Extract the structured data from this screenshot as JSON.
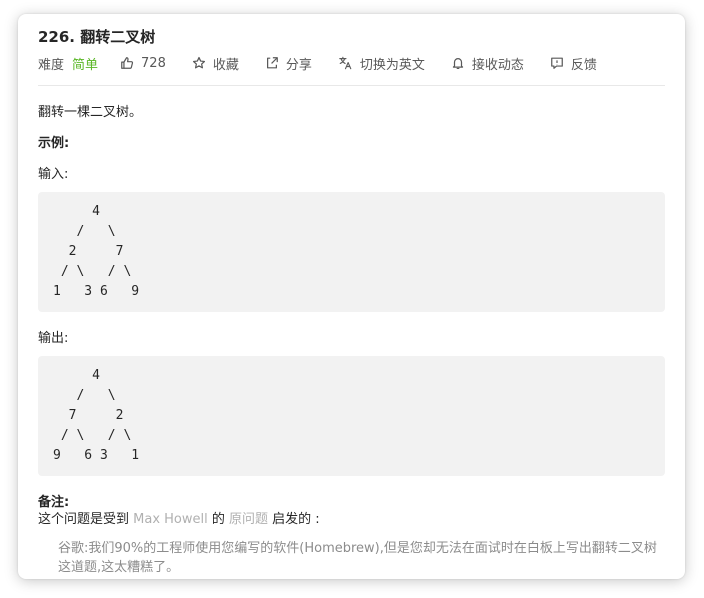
{
  "problem": {
    "title": "226. 翻转二叉树",
    "difficulty_label": "难度",
    "difficulty_value": "简单",
    "likes": "728",
    "collect_label": "收藏",
    "share_label": "分享",
    "lang_switch_label": "切换为英文",
    "follow_label": "接收动态",
    "feedback_label": "反馈"
  },
  "content": {
    "description": "翻转一棵二叉树。",
    "example_heading": "示例:",
    "input_label": "输入:",
    "input_tree": "     4\n   /   \\\n  2     7\n / \\   / \\\n1   3 6   9",
    "output_label": "输出:",
    "output_tree": "     4\n   /   \\\n  7     2\n / \\   / \\\n9   6 3   1",
    "note_heading": "备注:",
    "note_prefix": "这个问题是受到 ",
    "note_author": "Max Howell",
    "note_middle": " 的 ",
    "note_link": "原问题",
    "note_suffix": " 启发的 :",
    "quote": "谷歌:我们90%的工程师使用您编写的软件(Homebrew),但是您却无法在面试时在白板上写出翻转二叉树这道题,这太糟糕了。"
  },
  "colors": {
    "difficulty_easy": "#5ab726",
    "code_background": "#f2f2f2",
    "muted_link": "#b0b0b0"
  },
  "icons": [
    "thumbs-up-icon",
    "star-icon",
    "share-icon",
    "translate-icon",
    "bell-icon",
    "feedback-icon"
  ]
}
